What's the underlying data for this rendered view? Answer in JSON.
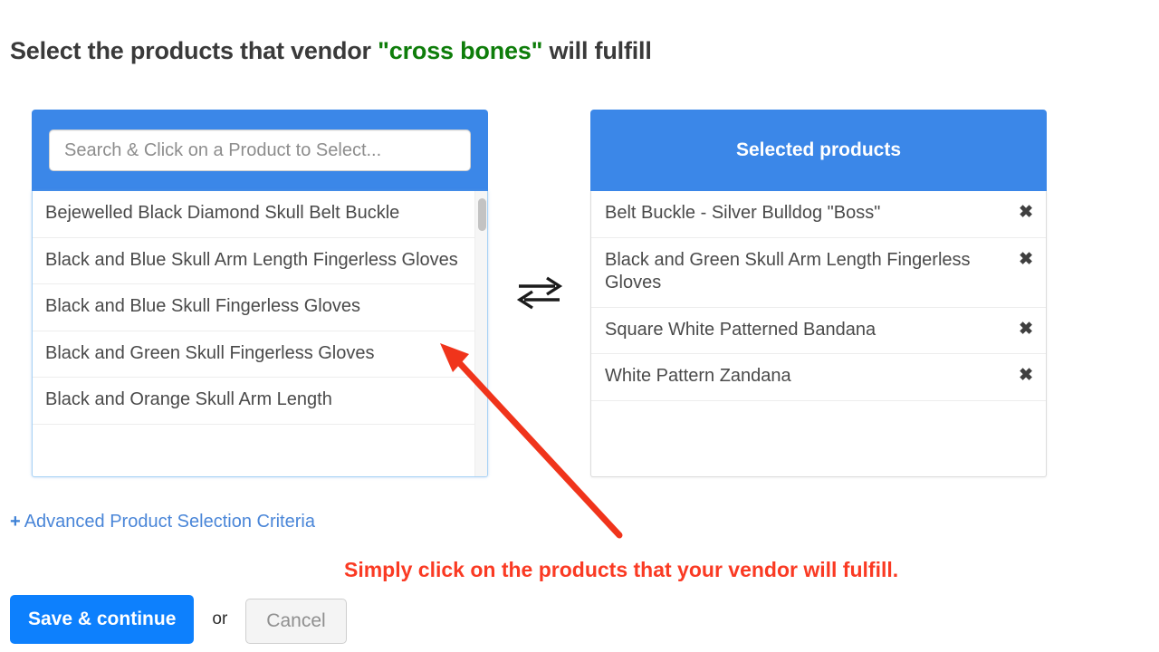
{
  "title": {
    "prefix": "Select the products that vendor ",
    "vendor": "\"cross bones\"",
    "suffix": " will fulfill"
  },
  "available_panel": {
    "search": {
      "placeholder": "Search & Click on a Product to Select...",
      "value": ""
    },
    "items": [
      "Bejewelled Black Diamond Skull Belt Buckle",
      "Black and Blue Skull Arm Length Fingerless Gloves",
      "Black and Blue Skull Fingerless Gloves",
      "Black and Green Skull Fingerless Gloves",
      "Black and Orange Skull Arm Length"
    ]
  },
  "swap_icon": "exchange-arrows-icon",
  "selected_panel": {
    "header": "Selected products",
    "items": [
      {
        "label": "Belt Buckle - Silver Bulldog \"Boss\"",
        "remove": "✖"
      },
      {
        "label": "Black and Green Skull Arm Length Fingerless Gloves",
        "remove": "✖"
      },
      {
        "label": "Square White Patterned Bandana",
        "remove": "✖"
      },
      {
        "label": "White Pattern Zandana",
        "remove": "✖"
      }
    ]
  },
  "advanced_link": {
    "plus": "+",
    "label": "Advanced Product Selection Criteria"
  },
  "annotation": {
    "text": "Simply click on the products that your vendor will fulfill.",
    "arrow": "red-arrow-icon"
  },
  "footer": {
    "save_label": "Save & continue",
    "or_label": "or",
    "cancel_label": "Cancel"
  },
  "colors": {
    "brand_blue": "#3b87e8",
    "button_blue": "#0d80fd",
    "vendor_green": "#0e7d0a",
    "annotation_red": "#fa3a23",
    "link_blue": "#4a86d8"
  }
}
